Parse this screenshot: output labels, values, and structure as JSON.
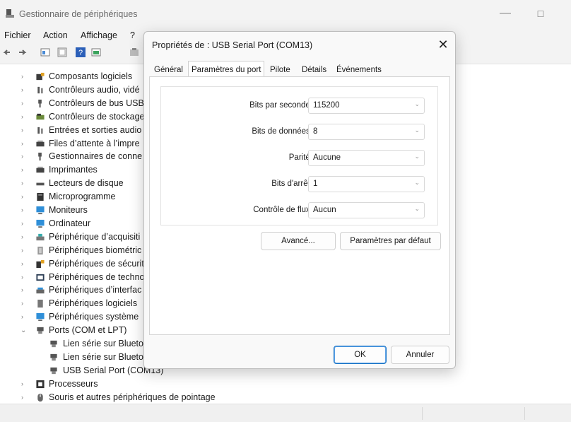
{
  "window": {
    "title": "Gestionnaire de périphériques",
    "minimize_glyph": "—",
    "maximize_glyph": "☐"
  },
  "menu": [
    "Fichier",
    "Action",
    "Affichage",
    "?"
  ],
  "tree": {
    "items": [
      {
        "label": "Composants logiciels",
        "icon": "software-components-icon",
        "chevron": "›"
      },
      {
        "label": "Contrôleurs audio, vidé",
        "icon": "audio-video-controller-icon",
        "chevron": "›"
      },
      {
        "label": "Contrôleurs de bus USB",
        "icon": "usb-controller-icon",
        "chevron": "›"
      },
      {
        "label": "Contrôleurs de stockage",
        "icon": "storage-controller-icon",
        "chevron": "›"
      },
      {
        "label": "Entrées et sorties audio",
        "icon": "audio-io-icon",
        "chevron": "›"
      },
      {
        "label": "Files d’attente à l’impre",
        "icon": "print-queue-icon",
        "chevron": "›"
      },
      {
        "label": "Gestionnaires de conne",
        "icon": "connection-manager-icon",
        "chevron": "›"
      },
      {
        "label": "Imprimantes",
        "icon": "printer-icon",
        "chevron": "›"
      },
      {
        "label": "Lecteurs de disque",
        "icon": "disk-drive-icon",
        "chevron": "›"
      },
      {
        "label": "Microprogramme",
        "icon": "firmware-icon",
        "chevron": "›"
      },
      {
        "label": "Moniteurs",
        "icon": "monitor-icon",
        "chevron": "›"
      },
      {
        "label": "Ordinateur",
        "icon": "computer-icon",
        "chevron": "›"
      },
      {
        "label": "Périphérique d’acquisiti",
        "icon": "imaging-device-icon",
        "chevron": "›"
      },
      {
        "label": "Périphériques biométric",
        "icon": "biometric-icon",
        "chevron": "›"
      },
      {
        "label": "Périphériques de sécurit",
        "icon": "security-device-icon",
        "chevron": "›"
      },
      {
        "label": "Périphériques de techno",
        "icon": "tech-device-icon",
        "chevron": "›"
      },
      {
        "label": "Périphériques d’interfac",
        "icon": "hid-icon",
        "chevron": "›"
      },
      {
        "label": "Périphériques logiciels",
        "icon": "software-device-icon",
        "chevron": "›"
      },
      {
        "label": "Périphériques système",
        "icon": "system-device-icon",
        "chevron": "›"
      },
      {
        "label": "Ports (COM et LPT)",
        "icon": "port-icon",
        "chevron": "⌄"
      }
    ],
    "children": [
      {
        "label": "Lien série sur Blueto",
        "icon": "port-icon"
      },
      {
        "label": "Lien série sur Blueto",
        "icon": "port-icon"
      },
      {
        "label": "USB Serial Port (COM13)",
        "icon": "port-icon"
      }
    ],
    "after": [
      {
        "label": "Processeurs",
        "icon": "processor-icon",
        "chevron": "›"
      },
      {
        "label": "Souris et autres périphériques de pointage",
        "icon": "mouse-icon",
        "chevron": "›"
      }
    ]
  },
  "dialog": {
    "title": "Propriétés de : USB Serial Port (COM13)",
    "close_glyph": "✕",
    "tabs": [
      "Général",
      "Paramètres du port",
      "Pilote",
      "Détails",
      "Événements"
    ],
    "active_tab": "Paramètres du port",
    "fields": [
      {
        "label": "Bits par seconde:",
        "value": "115200"
      },
      {
        "label": "Bits de données:",
        "value": "8"
      },
      {
        "label": "Parité:",
        "value": "Aucune"
      },
      {
        "label": "Bits d'arrêt:",
        "value": "1"
      },
      {
        "label": "Contrôle de flux:",
        "value": "Aucun"
      }
    ],
    "combo_arrow": "⌄",
    "advanced_button": "Avancé...",
    "defaults_button": "Paramètres par défaut",
    "ok_button": "OK",
    "cancel_button": "Annuler"
  },
  "colors": {
    "accent": "#1a73c4"
  }
}
